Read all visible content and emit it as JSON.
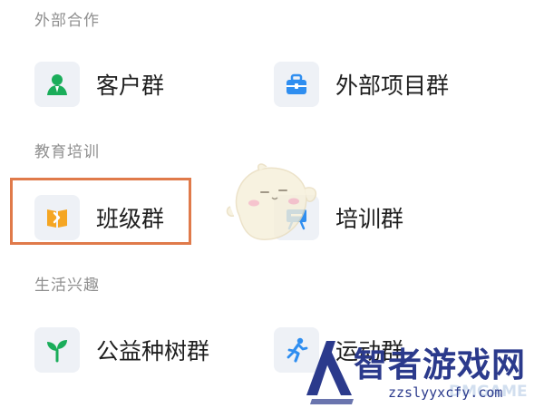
{
  "sections": [
    {
      "title": "外部合作",
      "items": [
        {
          "label": "客户群",
          "icon": "customer-person-icon",
          "color": "#1aad5a"
        },
        {
          "label": "外部项目群",
          "icon": "briefcase-icon",
          "color": "#2f8ef0"
        }
      ]
    },
    {
      "title": "教育培训",
      "items": [
        {
          "label": "班级群",
          "icon": "open-book-icon",
          "color": "#f5a623"
        },
        {
          "label": "培训群",
          "icon": "presentation-board-icon",
          "color": "#2f8ef0"
        }
      ]
    },
    {
      "title": "生活兴趣",
      "items": [
        {
          "label": "公益种树群",
          "icon": "sprout-icon",
          "color": "#1aad5a"
        },
        {
          "label": "运动群",
          "icon": "running-person-icon",
          "color": "#2f8ef0"
        }
      ]
    }
  ],
  "highlight_color": "#e07a4a",
  "watermark": {
    "title": "智者游戏网",
    "url": "zzslyyxcfy.com",
    "ghost_text": "DMGAME",
    "brand_color": "#2b3a8c"
  }
}
